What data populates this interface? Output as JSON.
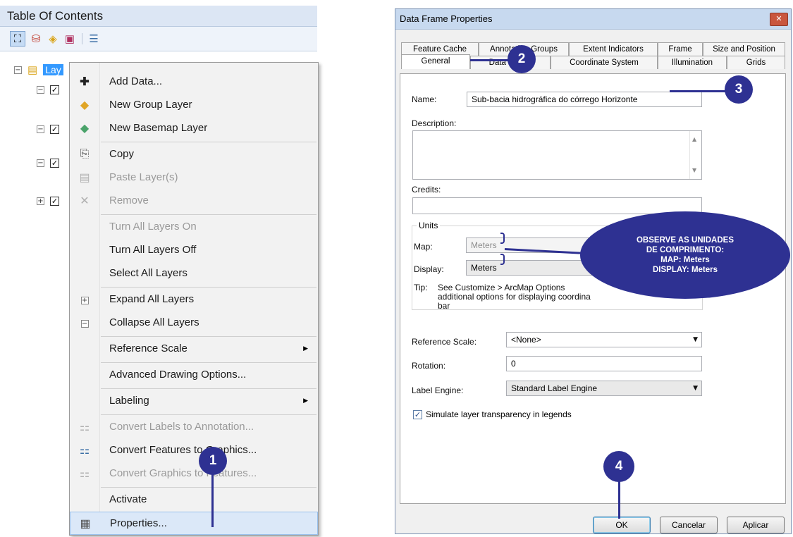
{
  "toc": {
    "title": "Table Of Contents",
    "toolbar_icons": [
      "list-by-drawing-order-icon",
      "list-by-source-icon",
      "list-by-visibility-icon",
      "list-by-selection-icon",
      "options-icon"
    ],
    "root_layer_label": "Lay",
    "context_menu": {
      "items": [
        {
          "label": "Add Data...",
          "icon": "add-data-icon",
          "enabled": true
        },
        {
          "label": "New Group Layer",
          "icon": "group-layer-icon",
          "enabled": true
        },
        {
          "label": "New Basemap Layer",
          "icon": "basemap-layer-icon",
          "enabled": true
        },
        {
          "label": "Copy",
          "icon": "copy-icon",
          "enabled": true
        },
        {
          "label": "Paste Layer(s)",
          "icon": "paste-icon",
          "enabled": false
        },
        {
          "label": "Remove",
          "icon": "remove-icon",
          "enabled": false
        },
        {
          "label": "Turn All Layers On",
          "enabled": false
        },
        {
          "label": "Turn All Layers Off",
          "enabled": true
        },
        {
          "label": "Select All Layers",
          "enabled": true
        },
        {
          "label": "Expand All Layers",
          "icon": "expand-icon",
          "enabled": true
        },
        {
          "label": "Collapse All Layers",
          "icon": "collapse-icon",
          "enabled": true
        },
        {
          "label": "Reference Scale",
          "enabled": true,
          "submenu": true
        },
        {
          "label": "Advanced Drawing Options...",
          "enabled": true
        },
        {
          "label": "Labeling",
          "enabled": true,
          "submenu": true
        },
        {
          "label": "Convert Labels to Annotation...",
          "icon": "convert-labels-icon",
          "enabled": false
        },
        {
          "label": "Convert Features to Graphics...",
          "icon": "convert-features-icon",
          "enabled": true
        },
        {
          "label": "Convert Graphics to Features...",
          "icon": "convert-graphics-icon",
          "enabled": false
        },
        {
          "label": "Activate",
          "enabled": true
        },
        {
          "label": "Properties...",
          "icon": "properties-icon",
          "enabled": true,
          "highlighted": true
        }
      ]
    }
  },
  "dialog": {
    "title": "Data Frame Properties",
    "tabs_row1": [
      "Feature Cache",
      "Annotation Groups",
      "Extent Indicators",
      "Frame",
      "Size and Position"
    ],
    "tabs_row2": [
      "General",
      "Data Frame",
      "Coordinate System",
      "Illumination",
      "Grids"
    ],
    "selected_tab": "General",
    "name_label": "Name:",
    "name_value": "Sub-bacia hidrográfica do córrego Horizonte",
    "description_label": "Description:",
    "description_value": "",
    "credits_label": "Credits:",
    "credits_value": "",
    "units_title": "Units",
    "map_label": "Map:",
    "map_value": "Meters",
    "display_label": "Display:",
    "display_value": "Meters",
    "tip_label": "Tip:",
    "tip_text_1": "See Customize > ArcMap Options",
    "tip_text_2": "additional options for displaying coordina",
    "tip_text_3": "bar",
    "reference_scale_label": "Reference Scale:",
    "reference_scale_value": "<None>",
    "rotation_label": "Rotation:",
    "rotation_value": "0",
    "label_engine_label": "Label Engine:",
    "label_engine_value": "Standard Label Engine",
    "simulate_transparency_label": "Simulate layer transparency in legends",
    "simulate_transparency_checked": true,
    "buttons": {
      "ok": "OK",
      "cancel": "Cancelar",
      "apply": "Aplicar"
    },
    "close_glyph": "✕"
  },
  "annotations": {
    "step1": "1",
    "step2": "2",
    "step3": "3",
    "step4": "4",
    "note_lines": [
      "OBSERVE AS UNIDADES",
      "DE COMPRIMENTO:",
      "MAP: Meters",
      "DISPLAY: Meters"
    ],
    "accent_color": "#2e3192"
  }
}
